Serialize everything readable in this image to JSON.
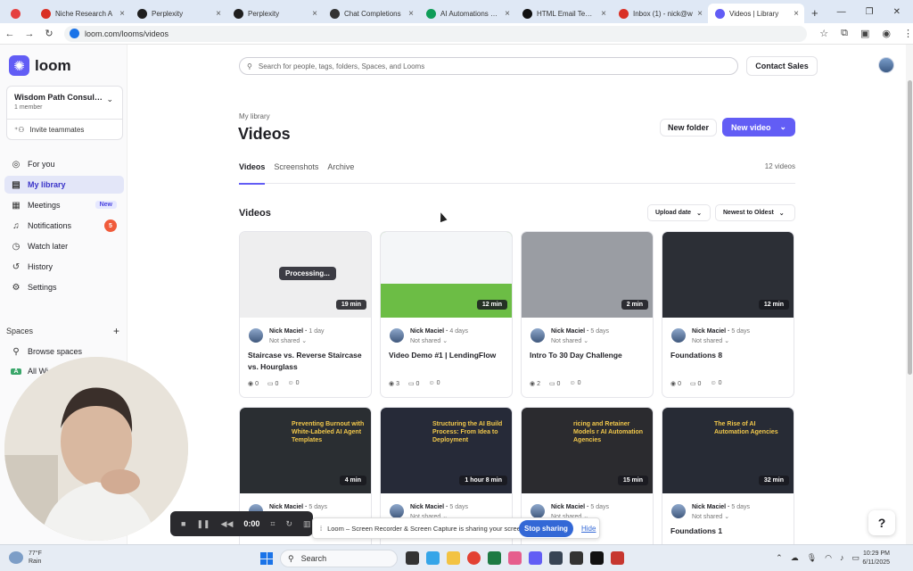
{
  "browser": {
    "tabs": [
      {
        "title": "",
        "favicon": "record-icon",
        "color": "#e54040"
      },
      {
        "title": "Niche Research A",
        "favicon": "gmail-icon",
        "color": "#d93025"
      },
      {
        "title": "Perplexity",
        "favicon": "perplexity-icon",
        "color": "#1f1f1f"
      },
      {
        "title": "Perplexity",
        "favicon": "perplexity-icon",
        "color": "#1f1f1f"
      },
      {
        "title": "Chat Completions",
        "favicon": "chat-icon",
        "color": "#333333"
      },
      {
        "title": "AI Automations Nic",
        "favicon": "sheets-icon",
        "color": "#0f9d58"
      },
      {
        "title": "HTML Email Templat",
        "favicon": "github-icon",
        "color": "#111111"
      },
      {
        "title": "Inbox (1) - nick@w",
        "favicon": "gmail-icon",
        "color": "#d93025"
      },
      {
        "title": "Videos | Library",
        "favicon": "loom-icon",
        "color": "#625df5",
        "active": true
      }
    ],
    "url": "loom.com/looms/videos"
  },
  "sidebar": {
    "logo": "loom",
    "workspace": {
      "name": "Wisdom Path Consulti...",
      "members": "1 member",
      "invite": "Invite teammates"
    },
    "nav": [
      {
        "label": "For you",
        "icon": "user-circle-icon"
      },
      {
        "label": "My library",
        "icon": "library-icon",
        "selected": true
      },
      {
        "label": "Meetings",
        "icon": "calendar-icon",
        "badge": "New"
      },
      {
        "label": "Notifications",
        "icon": "bell-icon",
        "count": "5"
      },
      {
        "label": "Watch later",
        "icon": "clock-icon"
      },
      {
        "label": "History",
        "icon": "history-icon"
      },
      {
        "label": "Settings",
        "icon": "gear-icon"
      }
    ],
    "spaces_label": "Spaces",
    "spaces": [
      {
        "label": "Browse spaces",
        "icon": "search-icon"
      },
      {
        "label": "All Wi",
        "icon": "space-a-icon"
      }
    ]
  },
  "header": {
    "search_placeholder": "Search for people, tags, folders, Spaces, and Looms",
    "contact_sales": "Contact Sales"
  },
  "library": {
    "eyebrow": "My library",
    "title": "Videos",
    "new_folder": "New folder",
    "new_video": "New video",
    "tabs": [
      "Videos",
      "Screenshots",
      "Archive"
    ],
    "count": "12 videos",
    "section": "Videos",
    "sort_field": "Upload date",
    "sort_order": "Newest to Oldest"
  },
  "videos": [
    {
      "title": "Staircase vs. Reverse Staircase vs. Hourglass",
      "duration": "19 min",
      "author": "Nick Maciel",
      "age": "1 day",
      "share": "Not shared",
      "views": "0",
      "comments": "0",
      "reactions": "0",
      "processing": "Processing...",
      "thumb": "#eeeeef"
    },
    {
      "title": "Video Demo #1 | LendingFlow",
      "duration": "12 min",
      "author": "Nick Maciel",
      "age": "4 days",
      "share": "Not shared",
      "views": "3",
      "comments": "0",
      "reactions": "0",
      "thumb": "#6cbd45"
    },
    {
      "title": "Intro To 30 Day Challenge",
      "duration": "2 min",
      "author": "Nick Maciel",
      "age": "5 days",
      "share": "Not shared",
      "views": "2",
      "comments": "0",
      "reactions": "0",
      "thumb": "#9a9da3"
    },
    {
      "title": "Foundations 8",
      "duration": "12 min",
      "author": "Nick Maciel",
      "age": "5 days",
      "share": "Not shared",
      "views": "0",
      "comments": "0",
      "reactions": "0",
      "thumb": "#2c2f36"
    },
    {
      "title": "",
      "duration": "4 min",
      "author": "Nick Maciel",
      "age": "5 days",
      "share": "Not shared",
      "thumb": "#2a2e32",
      "overlay": "Preventing Burnout with White-Labeled AI Agent Templates"
    },
    {
      "title": "",
      "duration": "1 hour 8 min",
      "author": "Nick Maciel",
      "age": "5 days",
      "share": "Not shared",
      "thumb": "#262a38",
      "overlay": "Structuring the AI Build Process: From Idea to Deployment"
    },
    {
      "title": "",
      "duration": "15 min",
      "author": "Nick Maciel",
      "age": "5 days",
      "share": "Not shared",
      "thumb": "#2b2b2f",
      "overlay": "ricing and Retainer Models r AI Automation Agencies"
    },
    {
      "title": "Foundations 1",
      "duration": "32 min",
      "author": "Nick Maciel",
      "age": "5 days",
      "share": "Not shared",
      "thumb": "#272b35",
      "overlay": "The Rise of AI Automation Agencies"
    }
  ],
  "recorder": {
    "time": "0:00",
    "message": "Loom – Screen Recorder & Screen Capture is sharing your screen.",
    "stop": "Stop sharing",
    "hide": "Hide"
  },
  "help": "?",
  "taskbar": {
    "temp": "77°F",
    "weather": "Rain",
    "search": "Search",
    "time": "10:29 PM",
    "date": "6/11/2025"
  }
}
